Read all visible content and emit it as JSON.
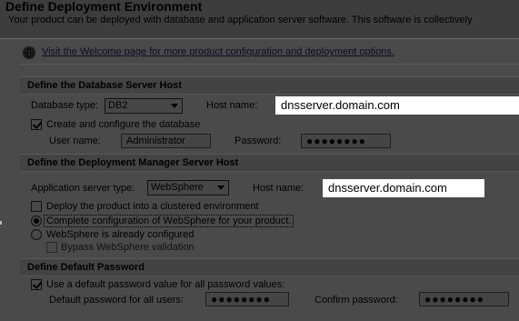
{
  "header": {
    "title": "Define Deployment Environment",
    "description": "Your product can be deployed with database and application server software.  This software is collectively"
  },
  "welcome_link": "Visit the Welcome page for more product configuration and deployment options.",
  "database": {
    "section_title": "Define the Database Server Host",
    "type_label": "Database type:",
    "type_value": "DB2",
    "host_label": "Host name:",
    "host_value": "dnsserver.domain.com",
    "create_label": "Create and configure the database",
    "create_checked": true,
    "user_label": "User name:",
    "user_value": "Administrator",
    "password_label": "Password:",
    "password_value": "●●●●●●●●"
  },
  "deployment_manager": {
    "section_title": "Define the Deployment Manager Server Host",
    "type_label": "Application server type:",
    "type_value": "WebSphere",
    "host_label": "Host name:",
    "host_value": "dnsserver.domain.com",
    "cluster_label": "Deploy the product into a clustered environment",
    "cluster_checked": false,
    "radio_complete_label": "Complete configuration of WebSphere for your product.",
    "radio_complete_selected": true,
    "radio_configured_label": "WebSphere is already configured",
    "radio_configured_selected": false,
    "bypass_label": "Bypass WebSphere validation",
    "bypass_checked": false
  },
  "default_password": {
    "section_title": "Define Default Password",
    "use_default_label": "Use a default password value for all password values:",
    "use_default_checked": true,
    "default_label": "Default password for all users:",
    "default_value": "●●●●●●●●",
    "confirm_label": "Confirm password:",
    "confirm_value": "●●●●●●●●"
  },
  "icons": {
    "welcome": "globe-help-icon",
    "select_arrow": "chevron-down-icon"
  },
  "colors": {
    "background": "#4a4a4a",
    "section_header": "#434343",
    "host_field": "#ffffff",
    "link": "#0b0b2a"
  }
}
